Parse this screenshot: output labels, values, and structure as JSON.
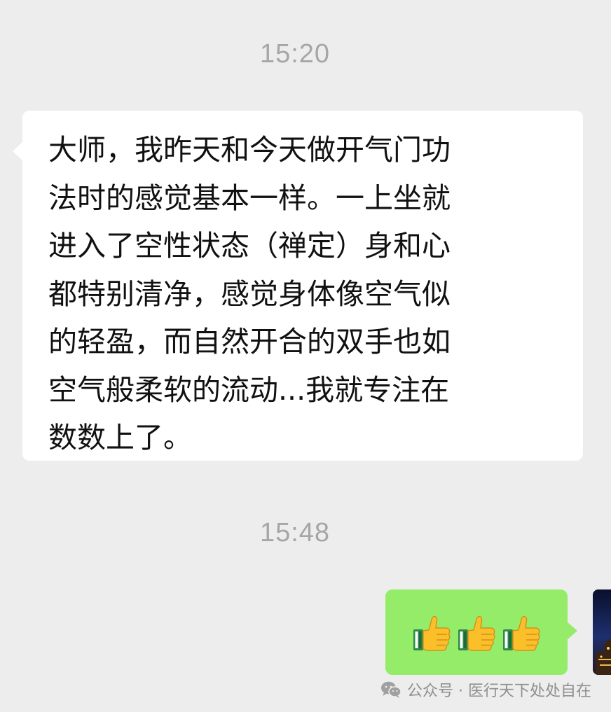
{
  "messages": [
    {
      "type": "timestamp",
      "text": "15:20"
    },
    {
      "type": "incoming",
      "text": "大师，我昨天和今天做开气门功\n法时的感觉基本一样。一上坐就\n进入了空性状态（禅定）身和心\n都特别清净，感觉身体像空气似\n的轻盈，而自然开合的双手也如\n空气般柔软的流动...我就专注在\n数数上了。"
    },
    {
      "type": "timestamp",
      "text": "15:48"
    },
    {
      "type": "outgoing",
      "emojis": [
        "thumbs-up-icon",
        "thumbs-up-icon",
        "thumbs-up-icon"
      ]
    }
  ],
  "watermark": {
    "icon": "wechat-official-account-icon",
    "text": "公众号 · 医行天下处处自在"
  },
  "colors": {
    "background": "#ededed",
    "incoming_bubble": "#ffffff",
    "outgoing_bubble": "#95ec69",
    "timestamp": "#a6a6a6",
    "message_text": "#111111",
    "watermark": "#8f8f8f"
  }
}
